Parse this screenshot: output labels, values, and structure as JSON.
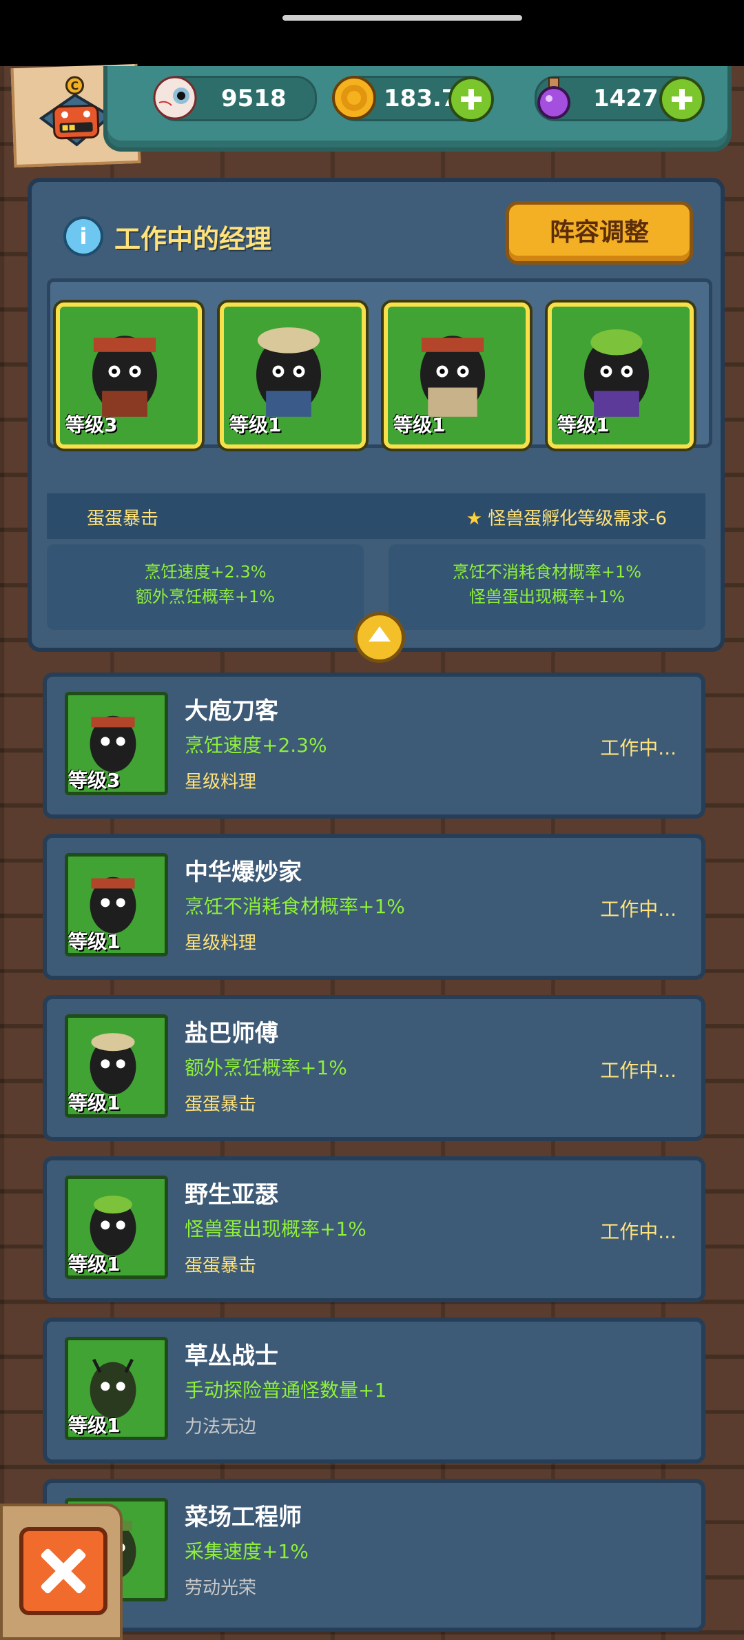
{
  "resources": {
    "eyes": "9518",
    "coins": "183.7k",
    "potion": "1427"
  },
  "panel": {
    "title": "工作中的经理",
    "adjust_label": "阵容调整",
    "cards": [
      {
        "level": "等级3"
      },
      {
        "level": "等级1"
      },
      {
        "level": "等级1"
      },
      {
        "level": "等级1"
      }
    ],
    "skill_name": "蛋蛋暴击",
    "skill_requirement": "怪兽蛋孵化等级需求-6",
    "bonus_left": [
      "烹饪速度+2.3%",
      "额外烹饪概率+1%"
    ],
    "bonus_right": [
      "烹饪不消耗食材概率+1%",
      "怪兽蛋出现概率+1%"
    ]
  },
  "managers": [
    {
      "name": "大庖刀客",
      "effect": "烹饪速度+2.3%",
      "tag": "星级料理",
      "level": "等级3",
      "status": "工作中..."
    },
    {
      "name": "中华爆炒家",
      "effect": "烹饪不消耗食材概率+1%",
      "tag": "星级料理",
      "level": "等级1",
      "status": "工作中..."
    },
    {
      "name": "盐巴师傅",
      "effect": "额外烹饪概率+1%",
      "tag": "蛋蛋暴击",
      "level": "等级1",
      "status": "工作中..."
    },
    {
      "name": "野生亚瑟",
      "effect": "怪兽蛋出现概率+1%",
      "tag": "蛋蛋暴击",
      "level": "等级1",
      "status": "工作中..."
    },
    {
      "name": "草丛战士",
      "effect": "手动探险普通怪数量+1",
      "tag": "力法无边",
      "level": "等级1",
      "status": ""
    },
    {
      "name": "菜场工程师",
      "effect": "采集速度+1%",
      "tag": "劳动光荣",
      "level": "",
      "status": ""
    }
  ],
  "colors": {
    "accent_yellow": "#ffe27a",
    "effect_green": "#8ef03a",
    "card_green": "#41a334"
  }
}
